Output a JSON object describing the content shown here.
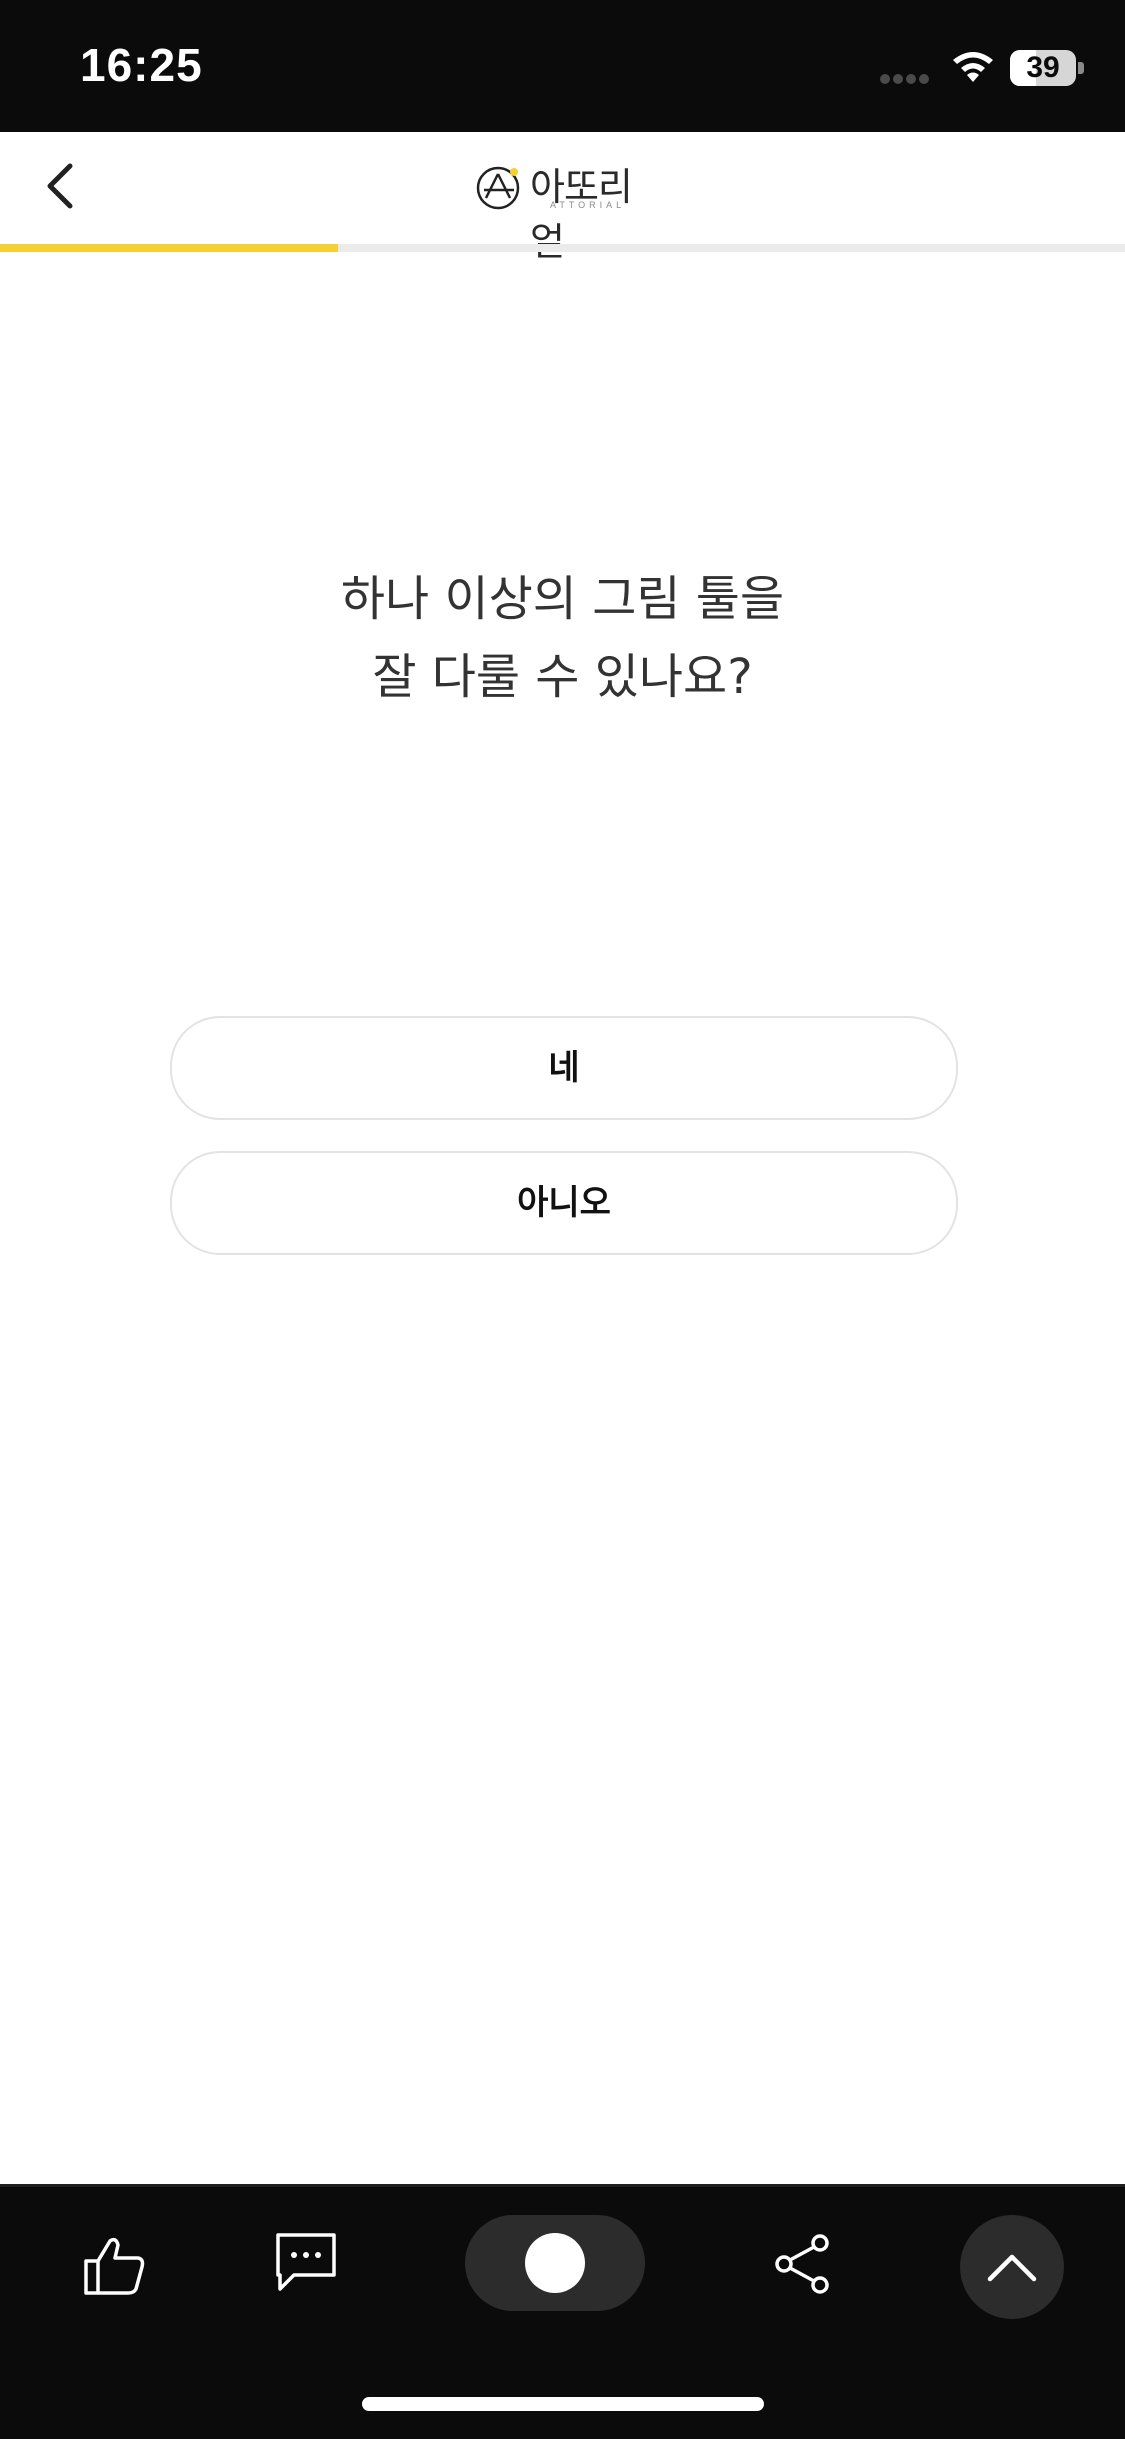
{
  "status_bar": {
    "time": "16:25",
    "battery_level": 39,
    "battery_text": "39",
    "icons": [
      "signal-dots-icon",
      "wifi-icon",
      "battery-icon"
    ]
  },
  "header": {
    "back_icon": "chevron-left-icon",
    "logo_text": "아또리얼",
    "logo_subtext": "ATTORIAL"
  },
  "progress": {
    "fraction": 0.3,
    "fill_color": "#f5d033",
    "track_color": "#ebebeb"
  },
  "question": {
    "line1": "하나 이상의 그림 툴을",
    "line2": "잘 다룰 수 있나요?"
  },
  "answers": {
    "yes_label": "네",
    "no_label": "아니오"
  },
  "bottom_bar": {
    "icons": [
      "thumbs-up-icon",
      "comment-icon",
      "toggle-switch",
      "share-icon",
      "chevron-up-icon"
    ],
    "toggle_state": "on"
  },
  "colors": {
    "accent": "#f5d033",
    "dark_bar": "#0b0b0b",
    "button_border": "#e3e3e3"
  }
}
